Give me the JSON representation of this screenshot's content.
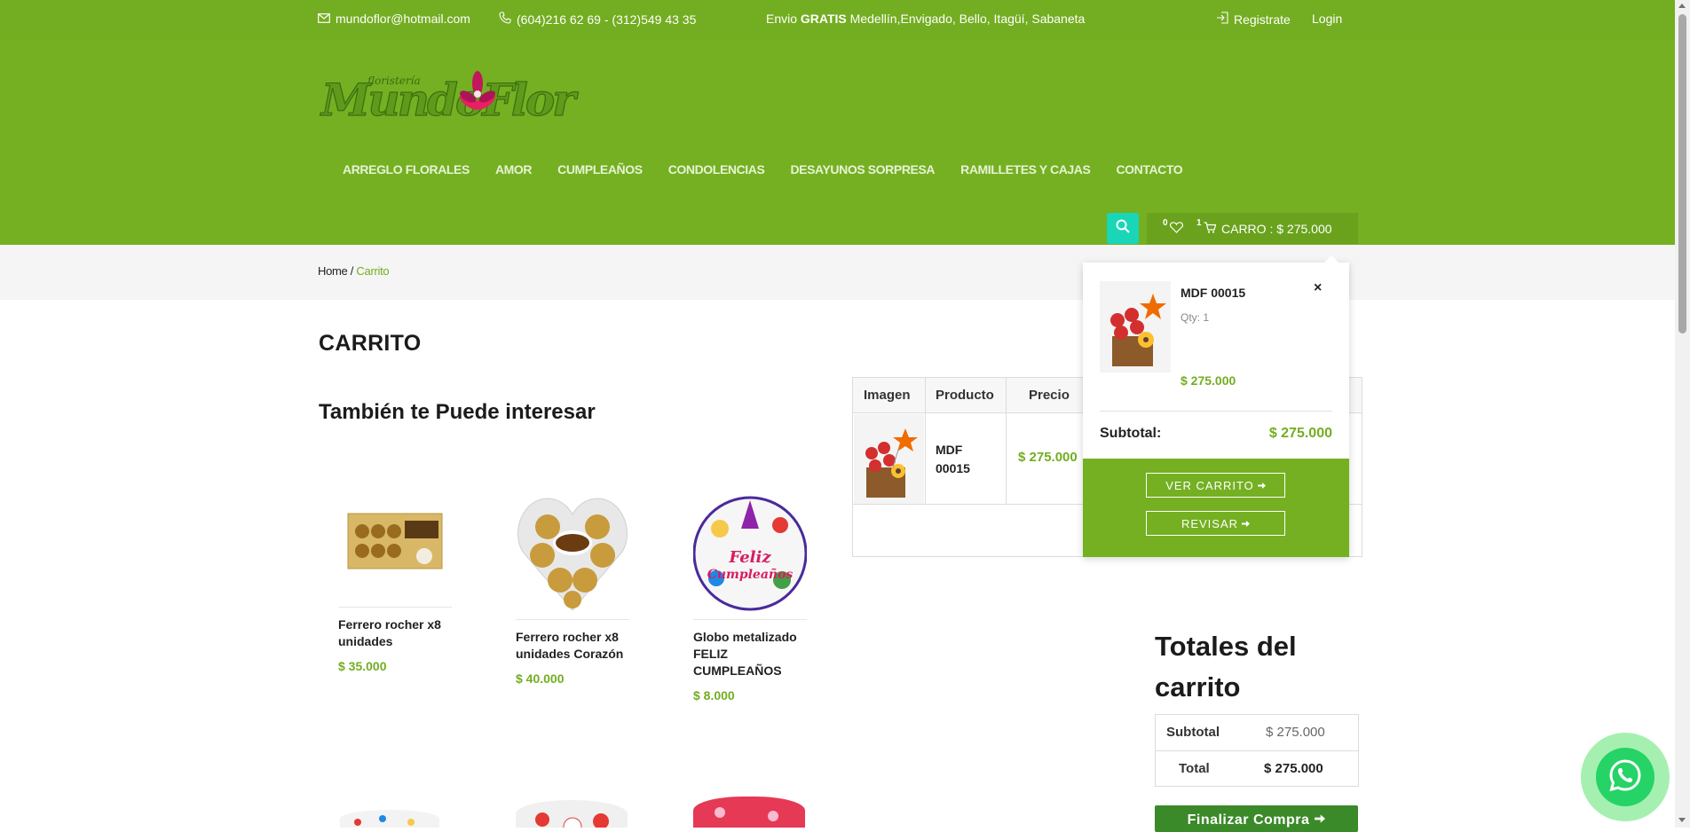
{
  "topbar": {
    "email": "mundoflor@hotmail.com",
    "phones": "(604)216 62 69 - (312)549 43 35",
    "shipping_prefix": "Envio ",
    "shipping_bold": "GRATIS",
    "shipping_rest": " Medellín,Envigado, Bello, Itagüí, Sabaneta",
    "register": "Registrate",
    "login": "Login"
  },
  "logo": {
    "small": "floristería",
    "main": "MundoFlor"
  },
  "nav": [
    "ARREGLO FLORALES",
    "AMOR",
    "CUMPLEAÑOS",
    "CONDOLENCIAS",
    "DESAYUNOS SORPRESA",
    "RAMILLETES Y CAJAS",
    "CONTACTO"
  ],
  "header_actions": {
    "wishlist_count": "0",
    "cart_count": "1",
    "cart_text": "CARRO : $ 275.000"
  },
  "breadcrumb": {
    "home": "Home",
    "sep": " / ",
    "current": "Carrito"
  },
  "page_title": "CARRITO",
  "related": {
    "title": "También te Puede interesar",
    "products": [
      {
        "name": "Ferrero rocher x8 unidades",
        "price": "$ 35.000"
      },
      {
        "name": "Ferrero rocher x8 unidades Corazón",
        "price": "$ 40.000"
      },
      {
        "name": "Globo metalizado FELIZ CUMPLEAÑOS",
        "price": "$ 8.000"
      }
    ]
  },
  "cart_table": {
    "headers": [
      "Imagen",
      "Producto",
      "Precio"
    ],
    "item": {
      "name_line1": "MDF",
      "name_line2": "00015",
      "price": "$ 275.000"
    }
  },
  "minicart": {
    "item_name": "MDF 00015",
    "qty": "Qty: 1",
    "item_price": "$ 275.000",
    "close": "×",
    "subtotal_label": "Subtotal:",
    "subtotal_value": "$ 275.000",
    "view_cart": "VER CARRITO",
    "checkout": "REVISAR"
  },
  "totals": {
    "title": "Totales del carrito",
    "subtotal_label": "Subtotal",
    "subtotal_value": "$ 275.000",
    "total_label": "Total",
    "total_value": "$ 275.000",
    "finalize": "Finalizar Compra"
  },
  "colors": {
    "brand_green": "#73ad21",
    "teal": "#19d6b8",
    "whatsapp": "#25d366"
  },
  "icons": [
    "mail-icon",
    "phone-icon",
    "login-icon",
    "search-icon",
    "heart-icon",
    "cart-icon",
    "arrow-right-icon",
    "whatsapp-icon"
  ]
}
